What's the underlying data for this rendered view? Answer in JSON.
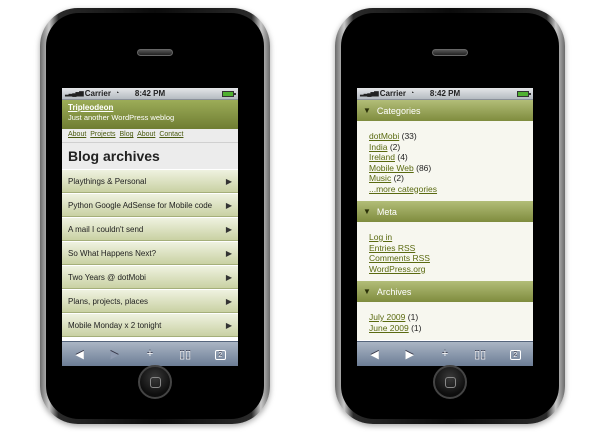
{
  "status": {
    "carrier": "Carrier",
    "time": "8:42 PM"
  },
  "left_phone": {
    "site_title": "Tripleodeon",
    "site_tagline": "Just another WordPress weblog",
    "nav": [
      "About",
      "Projects",
      "Blog",
      "About",
      "Contact"
    ],
    "page_title": "Blog archives",
    "posts": [
      "Playthings & Personal",
      "Python Google AdSense for Mobile code",
      "A mail I couldn't send",
      "So What Happens Next?",
      "Two Years @ dotMobi",
      "Plans, projects, places",
      "Mobile Monday x 2 tonight"
    ]
  },
  "right_phone": {
    "categories_header": "Categories",
    "categories": [
      {
        "name": "dotMobi",
        "count": "(33)"
      },
      {
        "name": "India",
        "count": "(2)"
      },
      {
        "name": "Ireland",
        "count": "(4)"
      },
      {
        "name": "Mobile Web",
        "count": "(86)"
      },
      {
        "name": "Music",
        "count": "(2)"
      }
    ],
    "more_categories": "...more categories",
    "meta_header": "Meta",
    "meta_links": [
      "Log in",
      "Entries RSS",
      "Comments RSS",
      "WordPress.org"
    ],
    "archives_header": "Archives",
    "archives": [
      {
        "name": "July 2009",
        "count": "(1)"
      },
      {
        "name": "June 2009",
        "count": "(1)"
      }
    ]
  },
  "toolbar": {
    "back": "◀",
    "forward": "▶",
    "add": "+",
    "bookmarks": "📖",
    "pages": "2"
  },
  "icons": {
    "section_toggle": "triangle-down-icon",
    "list_arrow": "chevron-right-icon"
  }
}
